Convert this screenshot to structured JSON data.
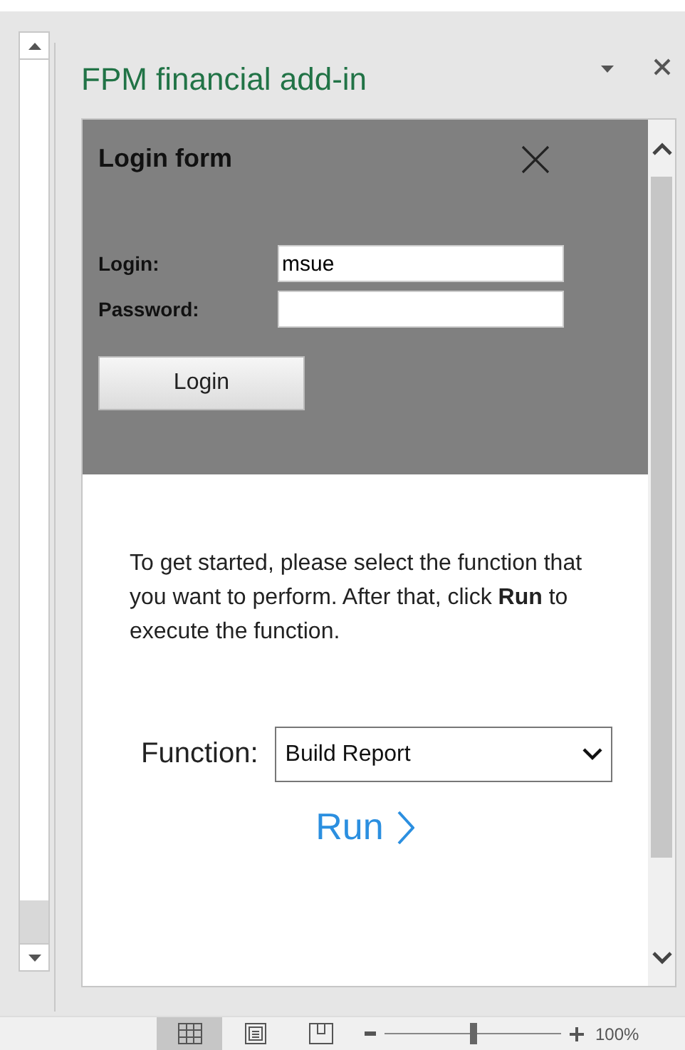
{
  "pane": {
    "title": "FPM financial add-in"
  },
  "login_form": {
    "title": "Login form",
    "fields": [
      {
        "label": "Login:",
        "value": "msue"
      },
      {
        "label": "Password:"
      }
    ],
    "button": "Login"
  },
  "intro": "To get started, please select the function that you want to perform. After that, click **Run** to execute the function.",
  "function": {
    "label": "Function:",
    "value": "Build Report"
  },
  "run_link": "Run",
  "status_bar": {
    "views": [
      {
        "kind": "normal",
        "selected": true
      },
      {
        "kind": "layout",
        "selected": false
      },
      {
        "kind": "pagebreak",
        "selected": false
      }
    ],
    "zoom": {
      "level": 0.5,
      "reading": "100%"
    }
  }
}
